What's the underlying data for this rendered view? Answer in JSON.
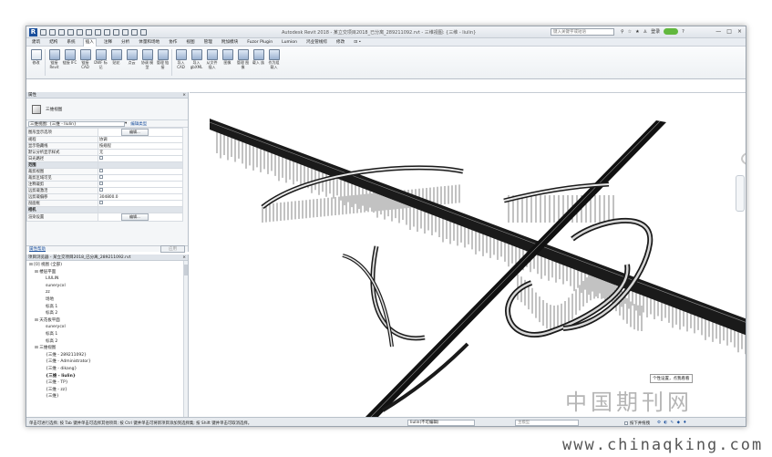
{
  "app": {
    "logo_letter": "R",
    "title": "Autodesk Revit 2018 - 某立交项目2018_已分离_289211092.rvt - 三维视图: {三维 - liulin}",
    "search_placeholder": "键入关键字或短语",
    "sign_in": "登录",
    "window_controls": [
      "—",
      "□",
      "×"
    ]
  },
  "menu": {
    "tabs": [
      "建筑",
      "结构",
      "系统",
      "插入",
      "注释",
      "分析",
      "体量和场地",
      "协作",
      "视图",
      "管理",
      "附加模块",
      "Fuzor Plugin",
      "Lumion",
      "鸿业管线综",
      "修改",
      "⊡ •"
    ],
    "active": "插入"
  },
  "ribbon": {
    "buttons": [
      "修改",
      "链接 Revit",
      "链接 IFC",
      "链接 CAD",
      "DWF 标记",
      "贴花",
      "点云",
      "协调 模型",
      "管理 链接",
      "导入 CAD",
      "导入 gbXML",
      "从文件 插入",
      "图像",
      "管理 图像",
      "载入 族",
      "作为组 载入"
    ]
  },
  "properties": {
    "header": "属性",
    "type_name": "三维视图",
    "instance_selector": "三维视图: {三维 - liulin}",
    "edit_type": "编辑类型",
    "rows": [
      {
        "k": "图形显示选项",
        "v": "编辑...",
        "kind": "button"
      },
      {
        "k": "规程",
        "v": "协调",
        "kind": "text"
      },
      {
        "k": "显示隐藏线",
        "v": "按规程",
        "kind": "text"
      },
      {
        "k": "默认分析显示样式",
        "v": "无",
        "kind": "text"
      },
      {
        "k": "日光路径",
        "v": "",
        "kind": "check"
      },
      {
        "k": "范围",
        "v": "",
        "kind": "group"
      },
      {
        "k": "裁剪视图",
        "v": "",
        "kind": "check"
      },
      {
        "k": "裁剪区域可见",
        "v": "",
        "kind": "check"
      },
      {
        "k": "注释裁剪",
        "v": "",
        "kind": "check"
      },
      {
        "k": "远剪裁激活",
        "v": "",
        "kind": "check"
      },
      {
        "k": "远剪裁偏移",
        "v": "304800.0",
        "kind": "text"
      },
      {
        "k": "剖面框",
        "v": "",
        "kind": "check"
      },
      {
        "k": "相机",
        "v": "",
        "kind": "group"
      },
      {
        "k": "渲染设置",
        "v": "编辑...",
        "kind": "button"
      }
    ],
    "help": "属性帮助",
    "apply": "应用"
  },
  "browser": {
    "header": "项目浏览器 - 某立交项目2018_已分离_289211092.rvt",
    "nodes": [
      {
        "t": "⊟ [0] 视图 (全部)",
        "d": 0
      },
      {
        "t": "⊟ 楼层平面",
        "d": 1
      },
      {
        "t": "LIULIN",
        "d": 3
      },
      {
        "t": "sunerycxl",
        "d": 3
      },
      {
        "t": "zz",
        "d": 3
      },
      {
        "t": "场地",
        "d": 3
      },
      {
        "t": "标高 1",
        "d": 3
      },
      {
        "t": "标高 2",
        "d": 3
      },
      {
        "t": "⊟ 天花板平面",
        "d": 1
      },
      {
        "t": "sunerycxl",
        "d": 3
      },
      {
        "t": "标高 1",
        "d": 3
      },
      {
        "t": "标高 2",
        "d": 3
      },
      {
        "t": "⊟ 三维视图",
        "d": 1
      },
      {
        "t": "{三维 - 289211092}",
        "d": 3
      },
      {
        "t": "{三维 - Administrator}",
        "d": 3
      },
      {
        "t": "{三维 - dikang}",
        "d": 3
      },
      {
        "t": "{三维 - liulin}",
        "d": 3,
        "bold": true
      },
      {
        "t": "{三维 - TP}",
        "d": 3
      },
      {
        "t": "{三维 - zz}",
        "d": 3
      },
      {
        "t": "{三维}",
        "d": 3
      }
    ]
  },
  "view_controls": {
    "scale": "1 : 100"
  },
  "tooltip": "个性设置，点我看看",
  "status": {
    "message": "单击可进行选择; 按 Tab 键并单击可选择其他项目; 按 Ctrl 键并单击可将新项目添加到选择集; 按 Shift 键并单击可取消选择。",
    "workset": "liulin(不可编辑)",
    "model": "主模型",
    "press_drag": "按下并拖拽"
  },
  "watermark": {
    "text": "中国期刊网",
    "site": "www.chinaqking.com"
  }
}
